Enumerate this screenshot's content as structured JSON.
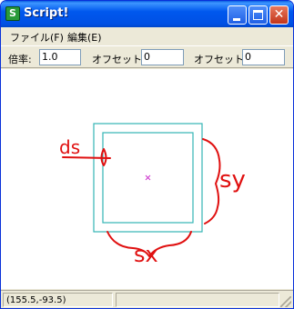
{
  "window": {
    "title": "Script!",
    "app_icon_glyph": "S",
    "title_color": "#ffffff",
    "titlebar_color": "#0054e3"
  },
  "menu": {
    "items": [
      {
        "label": "ファイル(F)"
      },
      {
        "label": "編集(E)"
      }
    ]
  },
  "toolbar": {
    "scale_label": "倍率:",
    "scale_value": "1.0",
    "offset_x_label": "オフセットX:",
    "offset_x_value": "0",
    "offset_y_label": "オフセットY:",
    "offset_y_value": "0"
  },
  "canvas": {
    "shape_color": "#33b5b5",
    "center_marker_color": "#cc33cc",
    "annotation_color": "#e01010",
    "annotations": {
      "ds": "ds",
      "sy": "sy",
      "sx": "sx"
    }
  },
  "status": {
    "coords": "(155.5,-93.5)"
  }
}
